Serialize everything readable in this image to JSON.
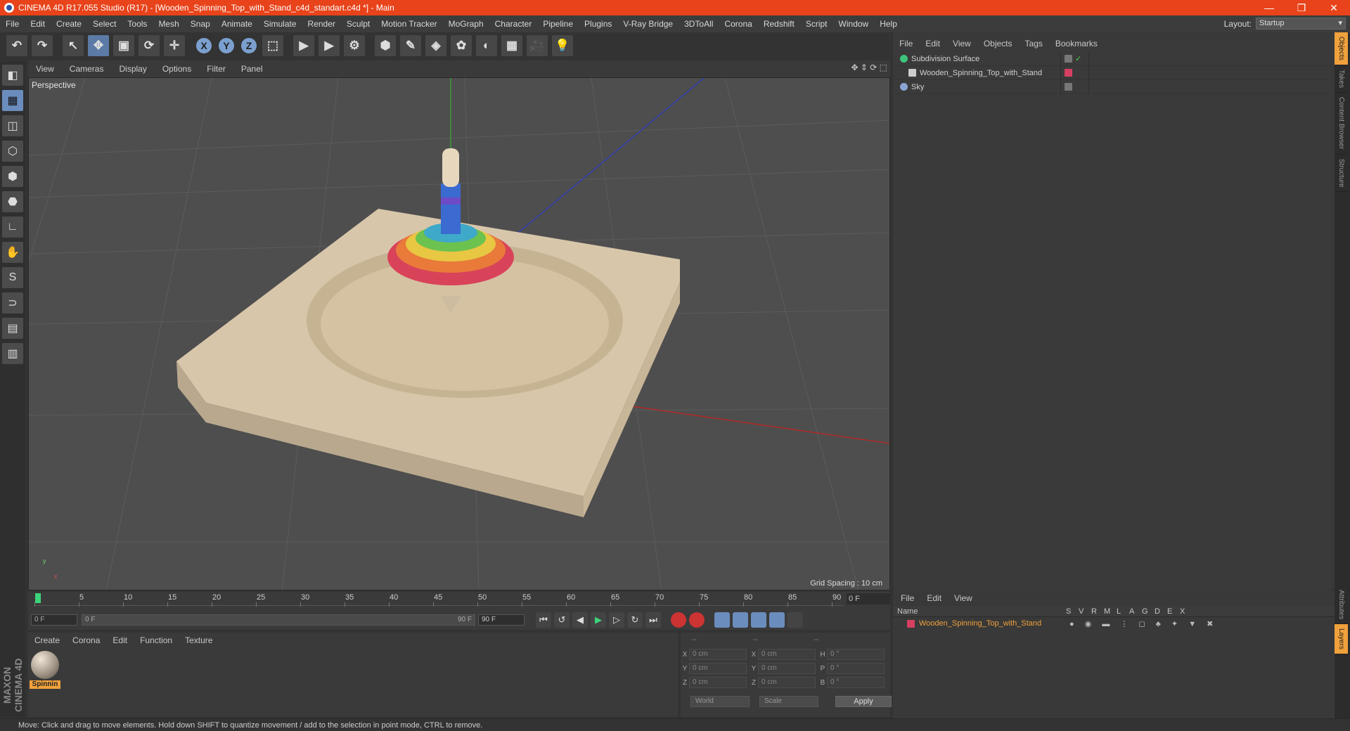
{
  "window": {
    "title": "CINEMA 4D R17.055 Studio (R17) - [Wooden_Spinning_Top_with_Stand_c4d_standart.c4d *] - Main",
    "min": "—",
    "restore": "❐",
    "close": "✕"
  },
  "menu": [
    "File",
    "Edit",
    "Create",
    "Select",
    "Tools",
    "Mesh",
    "Snap",
    "Animate",
    "Simulate",
    "Render",
    "Sculpt",
    "Motion Tracker",
    "MoGraph",
    "Character",
    "Pipeline",
    "Plugins",
    "V-Ray Bridge",
    "3DToAll",
    "Corona",
    "Redshift",
    "Script",
    "Window",
    "Help"
  ],
  "layout": {
    "label": "Layout:",
    "value": "Startup"
  },
  "toolbar": {
    "undo": "↶",
    "redo": "↷",
    "select": "↖",
    "move": "✥",
    "scale": "▣",
    "rotate": "⟳",
    "last": "✛",
    "x": "X",
    "y": "Y",
    "z": "Z",
    "coord": "⬚",
    "render_view": "▶",
    "render": "▶",
    "render_settings": "⚙",
    "cube": "⬢",
    "pen": "✎",
    "subdiv": "◈",
    "mograph": "✿",
    "deformer": "◐",
    "floor": "▦",
    "camera": "🎥",
    "light": "💡"
  },
  "lefttools": [
    "◧",
    "▦",
    "◫",
    "⬡",
    "⬢",
    "⬣",
    "∟",
    "✋",
    "S",
    "⊃",
    "▤",
    "▥"
  ],
  "viewport": {
    "menu": [
      "View",
      "Cameras",
      "Display",
      "Options",
      "Filter",
      "Panel"
    ],
    "label": "Perspective",
    "grid_spacing": "Grid Spacing : 10 cm",
    "controls": "✥ ⇕ ⟳ ⬚"
  },
  "objects": {
    "menu": [
      "File",
      "Edit",
      "View",
      "Objects",
      "Tags",
      "Bookmarks"
    ],
    "items": [
      {
        "name": "Subdivision Surface",
        "icon_color": "#3ec47a",
        "tag_color": "#777"
      },
      {
        "name": "Wooden_Spinning_Top_with_Stand",
        "icon_color": "#cccccc",
        "tag_color": "#d54060"
      },
      {
        "name": "Sky",
        "icon_color": "#8aa4d4",
        "tag_color": "#777"
      }
    ]
  },
  "righttabs": [
    "Objects",
    "Takes",
    "Content Browser",
    "Structure",
    "Attributes",
    "Layers"
  ],
  "attributes": {
    "menu": [
      "File",
      "Edit",
      "View"
    ],
    "header": {
      "name": "Name",
      "cols": [
        "S",
        "V",
        "R",
        "M",
        "L",
        "A",
        "G",
        "D",
        "E",
        "X"
      ]
    },
    "row": "Wooden_Spinning_Top_with_Stand"
  },
  "timeline": {
    "ticks": [
      "0",
      "5",
      "10",
      "15",
      "20",
      "25",
      "30",
      "35",
      "40",
      "45",
      "50",
      "55",
      "60",
      "65",
      "70",
      "75",
      "80",
      "85",
      "90"
    ],
    "frame_end_box": "0 F",
    "start": "0 F",
    "range_start": "0 F",
    "range_end": "90 F",
    "end": "90 F",
    "buttons": [
      "⏮",
      "↺",
      "◀",
      "▶",
      "▷",
      "↻",
      "⏭"
    ]
  },
  "material": {
    "menu": [
      "Create",
      "Corona",
      "Edit",
      "Function",
      "Texture"
    ],
    "name": "Spinnin"
  },
  "coords": {
    "head": [
      "--",
      "--",
      "--"
    ],
    "rows": [
      {
        "a": "X",
        "av": "0 cm",
        "b": "X",
        "bv": "0 cm",
        "c": "H",
        "cv": "0 °"
      },
      {
        "a": "Y",
        "av": "0 cm",
        "b": "Y",
        "bv": "0 cm",
        "c": "P",
        "cv": "0 °"
      },
      {
        "a": "Z",
        "av": "0 cm",
        "b": "Z",
        "bv": "0 cm",
        "c": "B",
        "cv": "0 °"
      }
    ],
    "world": "World",
    "scale": "Scale",
    "apply": "Apply"
  },
  "brand": "MAXON CINEMA 4D",
  "status": "Move: Click and drag to move elements. Hold down SHIFT to quantize movement / add to the selection in point mode, CTRL to remove."
}
